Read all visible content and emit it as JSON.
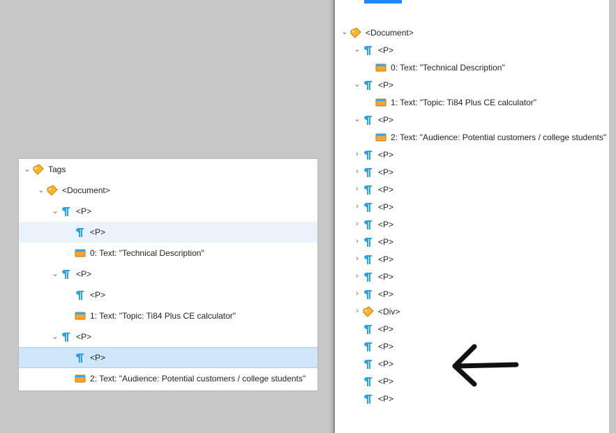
{
  "left": {
    "root_label": "Tags",
    "document_label": "<Document>",
    "p_label": "<P>",
    "text0": "0: Text: \"Technical Description\"",
    "text1": "1: Text: \"Topic: Ti84 Plus CE calculator\"",
    "text2": "2: Text: \"Audience: Potential customers / college students\""
  },
  "right": {
    "document_label": "<Document>",
    "p_label": "<P>",
    "div_label": "<Div>",
    "text0": "0: Text: \"Technical Description\"",
    "text1": "1: Text: \"Topic: Ti84 Plus CE calculator\"",
    "text2": "2: Text: \"Audience: Potential customers / college students\""
  }
}
